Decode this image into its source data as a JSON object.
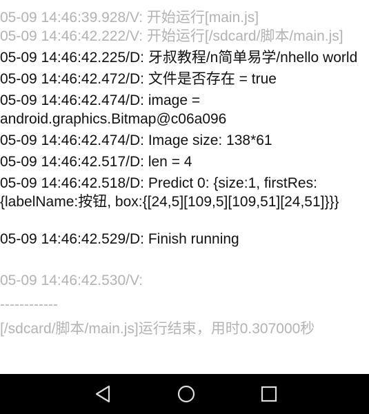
{
  "log": {
    "lines": [
      {
        "level": "V",
        "text": "05-09 14:46:39.928/V: 开始运行[main.js]"
      },
      {
        "level": "V",
        "text": "05-09 14:46:42.222/V: 开始运行[/sdcard/脚本/main.js]"
      },
      {
        "level": "D",
        "text": "05-09 14:46:42.225/D: 牙叔教程/n简单易学/nhello world"
      },
      {
        "level": "D",
        "text": "05-09 14:46:42.472/D: 文件是否存在 = true"
      },
      {
        "level": "D",
        "text": "05-09 14:46:42.474/D: image = android.graphics.Bitmap@c06a096"
      },
      {
        "level": "D",
        "text": "05-09 14:46:42.474/D: Image size: 138*61"
      },
      {
        "level": "D",
        "text": "05-09 14:46:42.517/D: len = 4"
      },
      {
        "level": "D",
        "text": "05-09 14:46:42.518/D: Predict 0: {size:1, firstRes:{labelName:按钮, box:{[24,5][109,5][109,51][24,51]}}}"
      },
      {
        "level": "D",
        "text": "05-09 14:46:42.529/D: Finish running"
      },
      {
        "level": "V",
        "text": "05-09 14:46:42.530/V: "
      },
      {
        "level": "V",
        "text": "------------"
      },
      {
        "level": "V",
        "text": "[/sdcard/脚本/main.js]运行结束，用时0.307000秒"
      }
    ]
  },
  "navbar": {
    "back_icon": "back-triangle-icon",
    "home_icon": "home-circle-icon",
    "recent_icon": "recent-square-icon",
    "background": "#000000"
  },
  "colors": {
    "verbose": "#b3b3b3",
    "debug": "#111111"
  }
}
